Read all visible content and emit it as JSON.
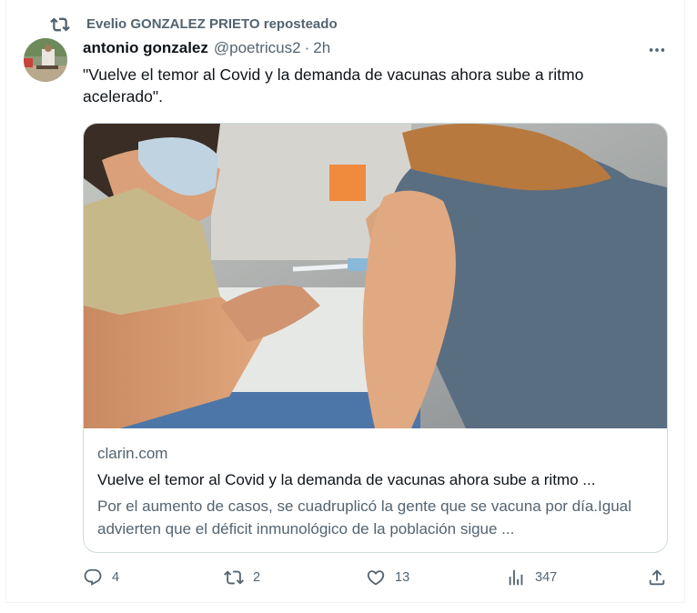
{
  "social_context": {
    "icon": "retweet-icon",
    "text": "Evelio GONZALEZ PRIETO reposteado"
  },
  "author": {
    "name": "antonio gonzalez",
    "handle": "@poetricus2",
    "separator": "·",
    "time": "2h"
  },
  "tweet": {
    "text": "\"Vuelve el temor al Covid y la demanda de vacunas ahora sube a ritmo acelerado\"."
  },
  "card": {
    "domain": "clarin.com",
    "title": "Vuelve el temor al Covid y la demanda de vacunas ahora sube a ritmo ...",
    "description": "Por el aumento de casos, se cuadruplicó la gente que se vacuna por día.Igual advierten que el déficit inmunológico de la población sigue ..."
  },
  "actions": {
    "replies": "4",
    "reposts": "2",
    "likes": "13",
    "views": "347"
  },
  "colors": {
    "secondary_text": "#536471",
    "primary_text": "#0f1419",
    "border": "#cfd9de"
  }
}
